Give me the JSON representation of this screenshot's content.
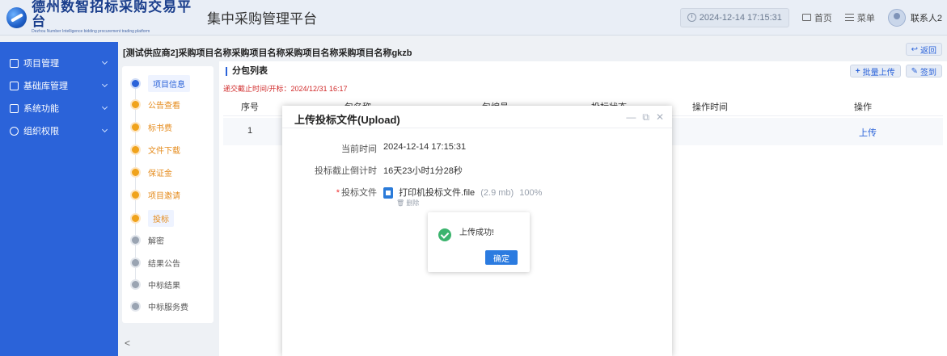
{
  "header": {
    "logo_cn": "德州数智招标采购交易平台",
    "logo_en": "Dezhou Number Intelligence bidding procurement trading platform",
    "platform_title": "集中采购管理平台",
    "datetime": "2024-12-14 17:15:31",
    "home_label": "首页",
    "menu_label": "菜单",
    "user_name": "联系人2"
  },
  "sidebar": {
    "items": [
      {
        "label": "项目管理"
      },
      {
        "label": "基础库管理"
      },
      {
        "label": "系统功能"
      },
      {
        "label": "组织权限"
      }
    ]
  },
  "main": {
    "project_title": "[测试供应商2]采购项目名称采购项目名称采购项目名称采购项目名称gkzb",
    "back_label": "返回",
    "batch_upload_label": "批量上传",
    "sign_label": "签到",
    "section_title": "分包列表",
    "deadline_text": "递交截止时间/开标：2024/12/31 16:17",
    "table": {
      "columns": [
        "序号",
        "包名称",
        "包编号",
        "投标状态",
        "操作时间",
        "操作"
      ],
      "rows": [
        {
          "index": "1",
          "action": "上传"
        }
      ]
    },
    "steps": [
      {
        "label": "项目信息",
        "state": "active"
      },
      {
        "label": "公告查看",
        "state": "done"
      },
      {
        "label": "标书费",
        "state": "done"
      },
      {
        "label": "文件下载",
        "state": "done"
      },
      {
        "label": "保证金",
        "state": "done"
      },
      {
        "label": "项目邀请",
        "state": "done"
      },
      {
        "label": "投标",
        "state": "current"
      },
      {
        "label": "解密",
        "state": "pending"
      },
      {
        "label": "结果公告",
        "state": "pending"
      },
      {
        "label": "中标结果",
        "state": "pending"
      },
      {
        "label": "中标服务费",
        "state": "pending"
      }
    ],
    "collapse_glyph": "<"
  },
  "modal": {
    "title": "上传投标文件(Upload)",
    "current_time_label": "当前时间",
    "current_time_value": "2024-12-14 17:15:31",
    "countdown_label": "投标截止倒计时",
    "countdown_value": "16天23小时1分28秒",
    "file_label": "投标文件",
    "file_name": "打印机投标文件.file",
    "file_size": "(2.9 mb)",
    "file_progress": "100%",
    "delete_label": "删除"
  },
  "success_dialog": {
    "message": "上传成功!",
    "ok_label": "确定"
  },
  "colors": {
    "primary": "#2b63d9",
    "step_done": "#f0a31c",
    "success": "#3cb46e",
    "danger": "#d12c2c"
  }
}
